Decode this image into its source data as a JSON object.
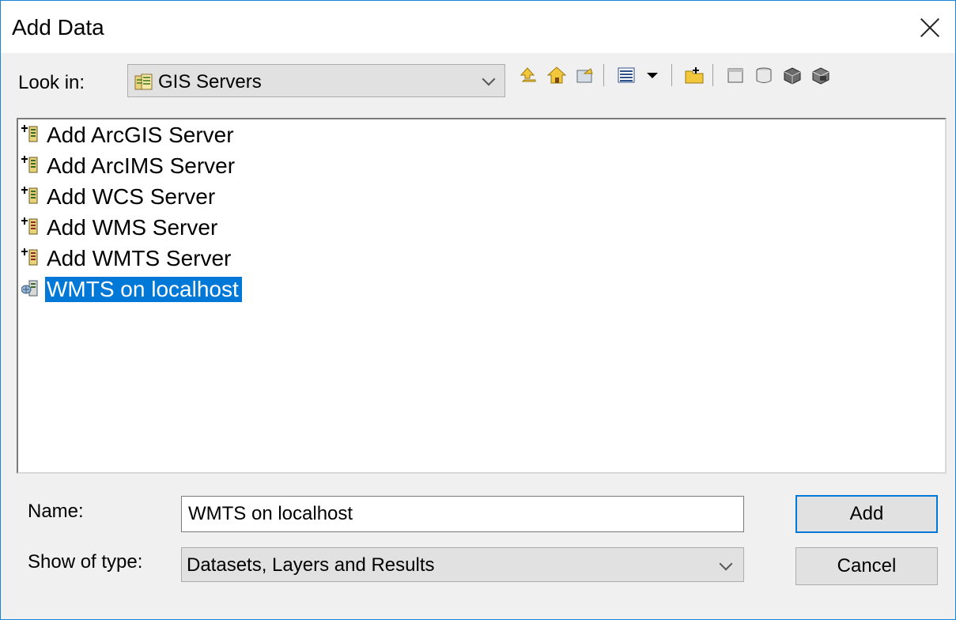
{
  "window": {
    "title": "Add Data"
  },
  "look_in": {
    "label": "Look in:",
    "value": "GIS Servers"
  },
  "toolbar": {
    "icons": [
      "up-one-level-icon",
      "home-icon",
      "connect-folder-icon",
      "list-view-icon",
      "view-dropdown-icon",
      "new-folder-icon",
      "new-file-icon",
      "new-database-icon",
      "server-icon",
      "server-connect-icon"
    ]
  },
  "file_list": {
    "items": [
      {
        "label": "Add ArcGIS Server",
        "icon": "add-server-icon",
        "selected": false
      },
      {
        "label": "Add ArcIMS Server",
        "icon": "add-server-icon",
        "selected": false
      },
      {
        "label": "Add WCS Server",
        "icon": "add-server-icon",
        "selected": false
      },
      {
        "label": "Add WMS Server",
        "icon": "add-server-icon",
        "selected": false
      },
      {
        "label": "Add WMTS Server",
        "icon": "add-server-icon",
        "selected": false
      },
      {
        "label": "WMTS on localhost",
        "icon": "wmts-server-icon",
        "selected": true
      }
    ]
  },
  "name_field": {
    "label": "Name:",
    "value": "WMTS on localhost"
  },
  "type_field": {
    "label": "Show of type:",
    "value": "Datasets, Layers and Results"
  },
  "buttons": {
    "add": "Add",
    "cancel": "Cancel"
  },
  "colors": {
    "selection": "#0078d7",
    "border": "#1883d7",
    "background": "#f0f0f0"
  }
}
